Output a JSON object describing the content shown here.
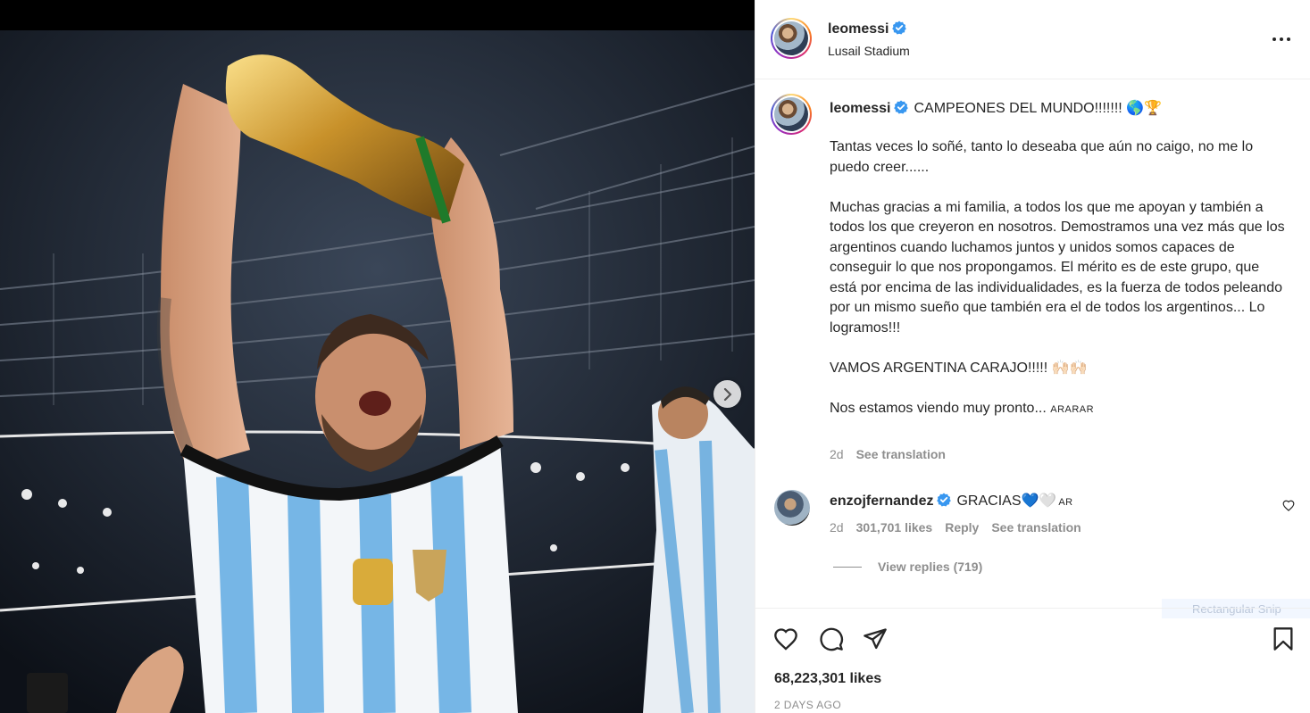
{
  "post": {
    "username": "leomessi",
    "location": "Lusail Stadium"
  },
  "caption": {
    "username": "leomessi",
    "headline": "CAMPEONES DEL MUNDO!!!!!!! 🌎🏆",
    "paragraphs": [
      "Tantas veces lo soñé, tanto lo deseaba que aún no caigo, no me lo puedo creer......",
      "Muchas gracias a mi familia, a todos los que me apoyan y también a todos los que creyeron en nosotros. Demostramos una vez más que los argentinos cuando luchamos juntos y unidos somos capaces de conseguir lo que nos propongamos. El mérito es de este grupo, que está por encima de las individualidades, es la fuerza de todos peleando por un mismo sueño que también era el de todos los argentinos... Lo logramos!!!",
      "VAMOS ARGENTINA CARAJO!!!!! 🙌🏻🙌🏻"
    ],
    "closing": "Nos estamos viendo muy pronto...",
    "closing_tag": "ARARAR",
    "age": "2d",
    "see_translation": "See translation"
  },
  "comment": {
    "username": "enzojfernandez",
    "text": "GRACIAS💙🤍",
    "tag": "AR",
    "age": "2d",
    "likes": "301,701 likes",
    "reply": "Reply",
    "see_translation": "See translation",
    "view_replies": "View replies (719)"
  },
  "snip_label": "Rectangular Snip",
  "footer": {
    "likes": "68,223,301 likes",
    "timestamp": "2 DAYS AGO"
  },
  "colors": {
    "verified": "#3897f0",
    "secondary_text": "#8e8e8e",
    "primary_text": "#262626"
  },
  "icons": [
    "verified-badge-icon",
    "more-options-icon",
    "chevron-right-icon",
    "heart-icon",
    "comment-icon",
    "share-icon",
    "bookmark-icon"
  ]
}
